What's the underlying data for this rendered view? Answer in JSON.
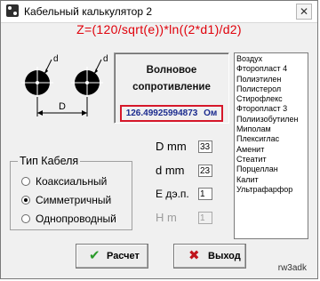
{
  "window": {
    "title": "Кабельный калькулятор 2",
    "close_glyph": "✕"
  },
  "formula": "Z=(120/sqrt(e))*ln((2*d1)/d2)",
  "diagram": {
    "label_d_top_left": "d",
    "label_d_top_right": "d",
    "label_D": "D"
  },
  "result": {
    "title_line1": "Волновое",
    "title_line2": "сопротивление",
    "value": "126.49925994873",
    "unit": "Ом"
  },
  "materials": [
    "Воздух",
    "Фторопласт 4",
    "Полиэтилен",
    "Полистерол",
    "Стирофлекс",
    "Фторопласт 3",
    "Полиизобутилен",
    "Миполам",
    "Плексиглас",
    "Аменит",
    "Стеатит",
    "Порцеллан",
    "Калит",
    "Ультрафарфор"
  ],
  "params": {
    "D_label": "D mm",
    "D_value": "33",
    "d_label": "d mm",
    "d_value": "23",
    "E_label": "E дэ.п.",
    "E_value": "1",
    "H_label": "H m",
    "H_value": "1"
  },
  "cable_type": {
    "legend": "Тип Кабеля",
    "options": [
      {
        "label": "Коаксиальный",
        "checked": false
      },
      {
        "label": "Симметричный",
        "checked": true
      },
      {
        "label": "Однопроводный",
        "checked": false
      }
    ]
  },
  "buttons": {
    "calc_label": "Расчет",
    "exit_label": "Выход"
  },
  "credit": "rw3adk",
  "colors": {
    "formula_red": "#e0000a",
    "value_blue": "#1a2a8e",
    "calc_green": "#2a9a2a",
    "exit_red": "#c0141c"
  }
}
